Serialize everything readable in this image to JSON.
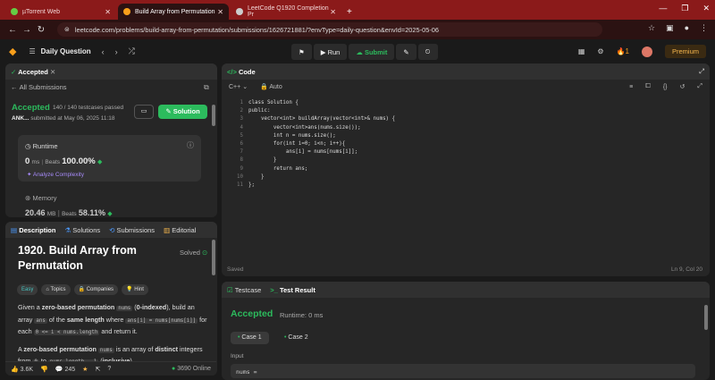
{
  "browser": {
    "tabs": [
      {
        "title": "µTorrent Web"
      },
      {
        "title": "Build Array from Permutation"
      },
      {
        "title": "LeetCode Q1920 Completion Pr"
      }
    ],
    "url": "leetcode.com/problems/build-array-from-permutation/submissions/1626721881/?envType=daily-question&envId=2025-05-06"
  },
  "header": {
    "title": "Daily Question",
    "run": "Run",
    "submit": "Submit",
    "streak": "1",
    "premium": "Premium"
  },
  "submission": {
    "tab": "Accepted",
    "back": "All Submissions",
    "status": "Accepted",
    "passed": "140 / 140 testcases passed",
    "user": "ANK...",
    "submitted": "submitted at May 06, 2025 11:18",
    "solution_btn": "Solution",
    "runtime_label": "Runtime",
    "runtime_value": "0",
    "runtime_unit": "ms",
    "beats_label": "Beats",
    "runtime_beats": "100.00%",
    "analyze": "Analyze Complexity",
    "memory_label": "Memory",
    "memory_value": "20.46",
    "memory_unit": "MB",
    "memory_beats": "58.11%"
  },
  "description": {
    "tabs": [
      "Description",
      "Solutions",
      "Submissions",
      "Editorial"
    ],
    "title": "1920. Build Array from Permutation",
    "solved": "Solved",
    "tags": [
      "Easy",
      "Topics",
      "Companies",
      "Hint"
    ],
    "likes": "3.6K",
    "comments": "245",
    "online": "3690 Online"
  },
  "code": {
    "tab": "Code",
    "lang": "C++",
    "mode": "Auto",
    "lines": [
      "class Solution {",
      "public:",
      "    vector<int> buildArray(vector<int>& nums) {",
      "        vector<int>ans(nums.size());",
      "        int n = nums.size();",
      "        for(int i=0; i<n; i++){",
      "            ans[i] = nums[nums[i]];",
      "        }",
      "        return ans;",
      "    }",
      "};"
    ],
    "saved": "Saved",
    "position": "Ln 9, Col 20"
  },
  "result": {
    "tab_testcase": "Testcase",
    "tab_result": "Test Result",
    "status": "Accepted",
    "runtime": "Runtime: 0 ms",
    "cases": [
      "Case 1",
      "Case 2"
    ],
    "input_label": "Input",
    "input_value": "nums ="
  },
  "colors": {
    "accent": "#2cbb5d",
    "brand": "#f89f1b",
    "tabbar": "#8b1a1a"
  }
}
